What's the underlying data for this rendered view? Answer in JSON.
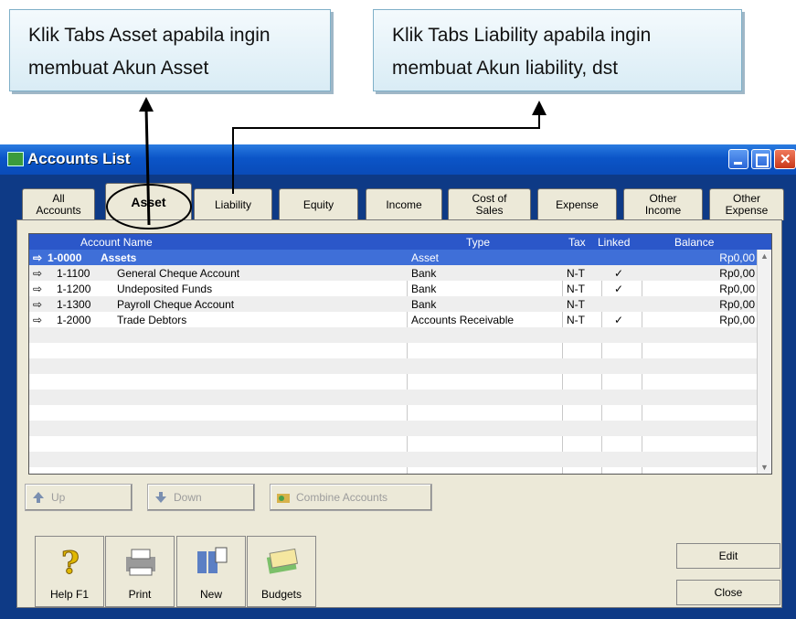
{
  "callouts": {
    "asset": {
      "line1": "Klik Tabs Asset apabila ingin",
      "line2": "membuat Akun Asset"
    },
    "liability": {
      "line1": "Klik Tabs Liability apabila ingin",
      "line2": "membuat Akun liability, dst"
    }
  },
  "window": {
    "title": "Accounts List"
  },
  "tabs": [
    {
      "line1": "All",
      "line2": "Accounts"
    },
    {
      "line1": "Asset",
      "line2": ""
    },
    {
      "line1": "Liability",
      "line2": ""
    },
    {
      "line1": "Equity",
      "line2": ""
    },
    {
      "line1": "Income",
      "line2": ""
    },
    {
      "line1": "Cost of",
      "line2": "Sales"
    },
    {
      "line1": "Expense",
      "line2": ""
    },
    {
      "line1": "Other",
      "line2": "Income"
    },
    {
      "line1": "Other",
      "line2": "Expense"
    }
  ],
  "active_tab": "Asset",
  "grid": {
    "headers": {
      "name": "Account Name",
      "type": "Type",
      "tax": "Tax",
      "linked": "Linked",
      "balance": "Balance"
    },
    "rows": [
      {
        "number": "1-0000",
        "name": "Assets",
        "type": "Asset",
        "tax": "",
        "linked": "",
        "balance": "Rp0,00"
      },
      {
        "number": "1-1100",
        "name": "General Cheque Account",
        "type": "Bank",
        "tax": "N-T",
        "linked": "✓",
        "balance": "Rp0,00"
      },
      {
        "number": "1-1200",
        "name": "Undeposited Funds",
        "type": "Bank",
        "tax": "N-T",
        "linked": "✓",
        "balance": "Rp0,00"
      },
      {
        "number": "1-1300",
        "name": "Payroll Cheque Account",
        "type": "Bank",
        "tax": "N-T",
        "linked": "",
        "balance": "Rp0,00"
      },
      {
        "number": "1-2000",
        "name": "Trade Debtors",
        "type": "Accounts Receivable",
        "tax": "N-T",
        "linked": "✓",
        "balance": "Rp0,00"
      }
    ]
  },
  "actions": {
    "up": "Up",
    "down": "Down",
    "combine": "Combine Accounts"
  },
  "toolbar": {
    "help": "Help F1",
    "print": "Print",
    "new": "New",
    "budgets": "Budgets"
  },
  "buttons": {
    "edit": "Edit",
    "close": "Close"
  },
  "colors": {
    "window_bg": "#0e3a86",
    "titlebar": "#0b55c8",
    "selection": "#3f6fd8"
  }
}
